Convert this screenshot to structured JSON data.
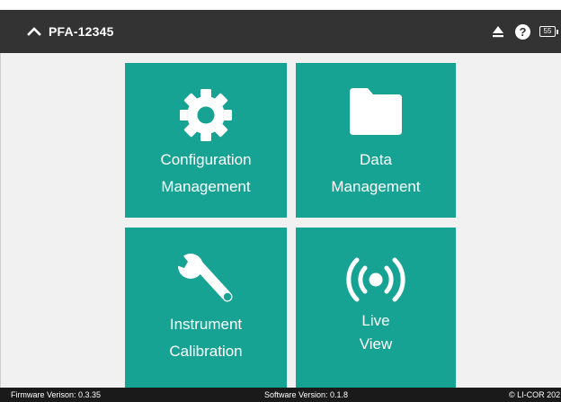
{
  "header": {
    "device_name": "PFA-12345",
    "help_label": "?",
    "battery_level": "55"
  },
  "tiles": [
    {
      "label_line1": "Configuration",
      "label_line2": "Management",
      "icon": "gear-icon"
    },
    {
      "label_line1": "Data",
      "label_line2": "Management",
      "icon": "folder-icon"
    },
    {
      "label_line1": "Instrument",
      "label_line2": "Calibration",
      "icon": "wrench-icon"
    },
    {
      "label_line1": "Live",
      "label_line2": "View",
      "icon": "broadcast-icon"
    }
  ],
  "footer": {
    "firmware": "Firmware Verison: 0.3.35",
    "software": "Software Version: 0.1.8",
    "copyright": "© LI-COR 202"
  },
  "colors": {
    "header_bg": "#333333",
    "tile_bg": "#16a393",
    "content_bg": "#f1f1f1",
    "footer_bg": "#1a1a1a"
  }
}
